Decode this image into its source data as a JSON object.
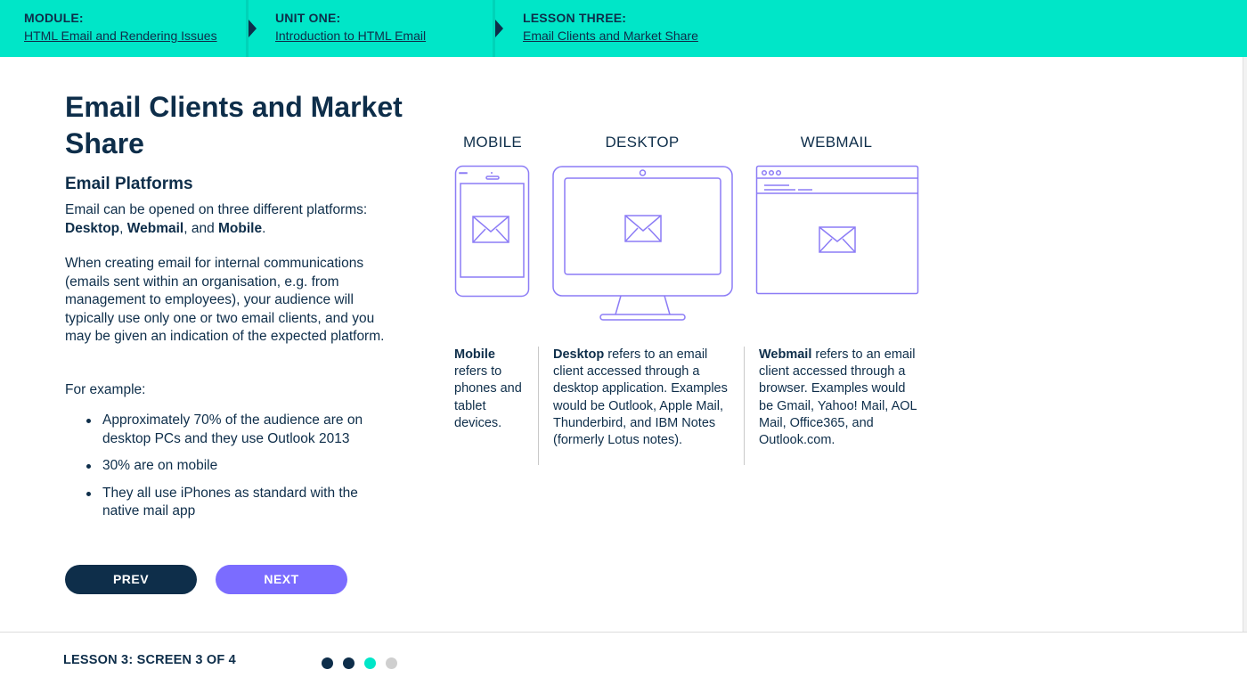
{
  "breadcrumb": [
    {
      "heading": "MODULE:",
      "link": "HTML Email and Rendering Issues"
    },
    {
      "heading": "UNIT ONE:",
      "link": "Introduction to HTML Email"
    },
    {
      "heading": "LESSON THREE:",
      "link": "Email Clients and Market Share"
    }
  ],
  "page": {
    "title": "Email Clients and Market Share",
    "subheading": "Email Platforms",
    "intro_text": "Email can be opened on three different platforms:",
    "intro_bold": [
      "Desktop",
      "Webmail",
      "Mobile"
    ],
    "intro_sep1": ", ",
    "intro_sep2": ", and ",
    "intro_end": ".",
    "paragraph2": "When creating email for internal communications (emails sent within an organisation, e.g. from management to employees), your audience will typically use only one or two email clients, and you may be given an indication of the expected platform.",
    "paragraph3": "For example:",
    "bullets": [
      "Approximately 70% of the audience are on desktop PCs and they use Outlook 2013",
      "30% are on mobile",
      "They all use iPhones as standard with the native mail app"
    ]
  },
  "buttons": {
    "prev": "PREV",
    "next": "NEXT"
  },
  "platforms": [
    {
      "label": "MOBILE",
      "icon": "mobile-phone-envelope-icon",
      "bold": "Mobile",
      "text": " refers to phones and tablet devices."
    },
    {
      "label": "DESKTOP",
      "icon": "desktop-monitor-envelope-icon",
      "bold": "Desktop",
      "text": " refers to an email client accessed through a desktop application. Examples would be Outlook, Apple Mail, Thunderbird, and IBM Notes (formerly Lotus notes)."
    },
    {
      "label": "WEBMAIL",
      "icon": "browser-window-envelope-icon",
      "bold": "Webmail",
      "text": " refers to an email client accessed through a browser. Examples would be Gmail, Yahoo! Mail, AOL Mail, Office365, and Outlook.com."
    }
  ],
  "footer": {
    "label": "LESSON 3: SCREEN 3 OF 4",
    "current_screen": 3,
    "total_screens": 4
  },
  "colors": {
    "top_bar": "#00e6c8",
    "navy": "#0e2e4a",
    "purple": "#7b6cff",
    "icon_stroke": "#8c7cf6",
    "dot_inactive": "#cfcfcf"
  }
}
